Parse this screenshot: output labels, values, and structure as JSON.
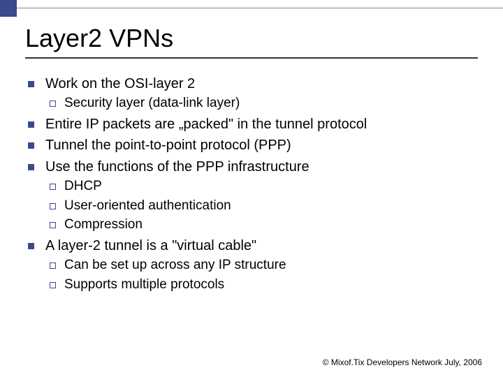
{
  "title": "Layer2 VPNs",
  "bullets": [
    {
      "text": "Work on the OSI-layer 2",
      "subs": [
        "Security layer (data-link layer)"
      ]
    },
    {
      "text": "Entire IP packets are „packed\" in the tunnel protocol",
      "subs": []
    },
    {
      "text": "Tunnel the point-to-point protocol (PPP)",
      "subs": []
    },
    {
      "text": "Use the functions of the PPP infrastructure",
      "subs": [
        "DHCP",
        "User-oriented authentication",
        "Compression"
      ]
    },
    {
      "text": "A layer-2 tunnel is a \"virtual cable\"",
      "subs": [
        "Can be set up across any IP structure",
        "Supports multiple protocols"
      ]
    }
  ],
  "footer": "© Mixof.Tix Developers Network July, 2006"
}
